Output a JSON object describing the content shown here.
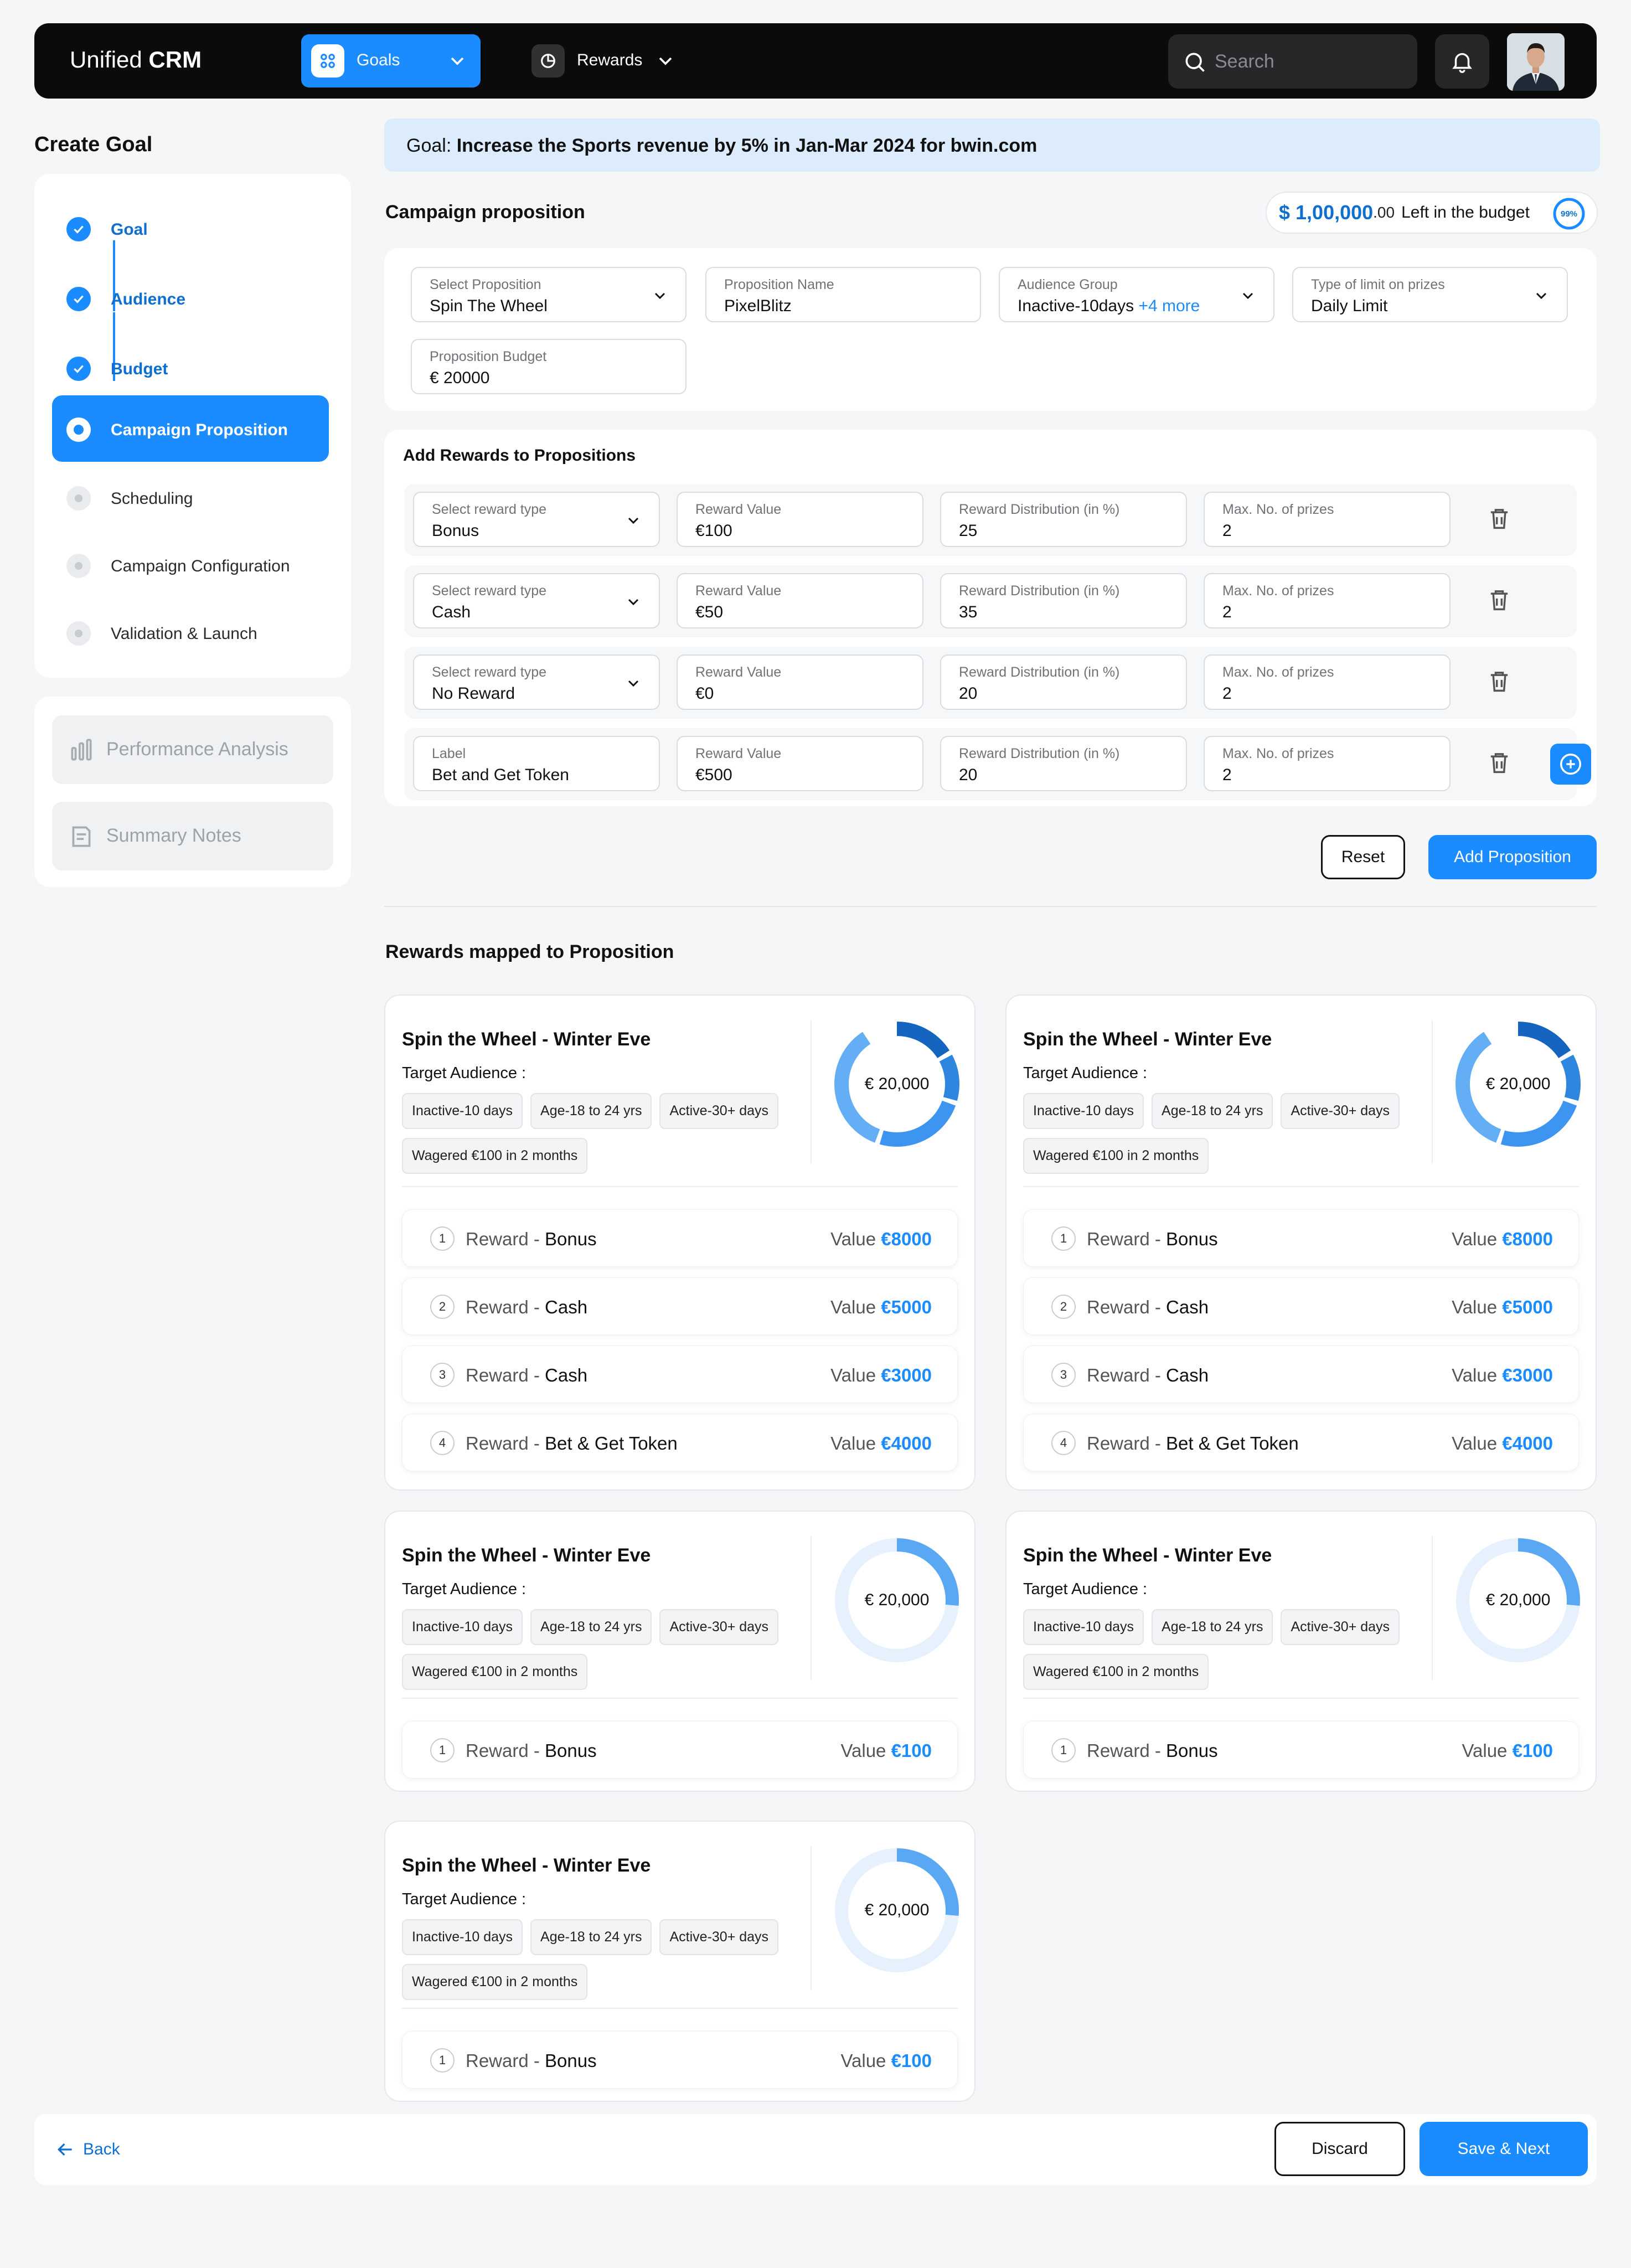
{
  "header": {
    "brand_light": "Unified ",
    "brand_bold": "CRM",
    "nav": [
      {
        "label": "Goals",
        "active": true
      },
      {
        "label": "Rewards",
        "active": false
      }
    ],
    "search_placeholder": "Search"
  },
  "sidebar": {
    "title": "Create Goal",
    "steps": [
      {
        "label": "Goal",
        "state": "done"
      },
      {
        "label": "Audience",
        "state": "done"
      },
      {
        "label": "Budget",
        "state": "done"
      },
      {
        "label": "Campaign Proposition",
        "state": "active"
      },
      {
        "label": "Scheduling",
        "state": "todo"
      },
      {
        "label": "Campaign Configuration",
        "state": "todo"
      },
      {
        "label": "Validation & Launch",
        "state": "todo"
      }
    ],
    "extras": [
      {
        "label": "Performance Analysis"
      },
      {
        "label": "Summary Notes"
      }
    ]
  },
  "goal": {
    "prefix": "Goal: ",
    "text": "Increase the Sports revenue by 5% in Jan-Mar 2024 for bwin.com"
  },
  "campaign": {
    "title": "Campaign proposition",
    "budget": {
      "amount": "$ 1,00,000",
      "cents": ".00",
      "suffix": "Left in the budget",
      "percent_label": "99%",
      "percent": 99
    }
  },
  "proposition_form": {
    "select_proposition": {
      "label": "Select Proposition",
      "value": "Spin The Wheel"
    },
    "proposition_name": {
      "label": "Proposition Name",
      "value": "PixelBlitz"
    },
    "audience_group": {
      "label": "Audience Group",
      "value": "Inactive-10days",
      "more": "+4 more"
    },
    "limit_type": {
      "label": "Type of limit on prizes",
      "value": "Daily Limit"
    },
    "proposition_budget": {
      "label": "Proposition Budget",
      "value": "€ 20000"
    }
  },
  "add_rewards": {
    "title": "Add Rewards to Propositions",
    "col_labels": {
      "value": "Reward Value",
      "distribution": "Reward Distribution (in %)",
      "max": "Max. No. of prizes"
    },
    "rows": [
      {
        "type_label": "Select reward type",
        "type": "Bonus",
        "value": "€100",
        "distribution": "25",
        "max": "2"
      },
      {
        "type_label": "Select reward type",
        "type": "Cash",
        "value": "€50",
        "distribution": "35",
        "max": "2"
      },
      {
        "type_label": "Select reward type",
        "type": "No Reward",
        "value": "€0",
        "distribution": "20",
        "max": "2"
      },
      {
        "type_label": "Label",
        "type": "Bet and Get Token",
        "value": "€500",
        "distribution": "20",
        "max": "2"
      }
    ]
  },
  "actions": {
    "reset": "Reset",
    "add_proposition": "Add Proposition"
  },
  "mapped": {
    "title": "Rewards mapped to Proposition",
    "card_title": "Spin the Wheel - Winter Eve",
    "target_label": "Target Audience :",
    "chips": [
      "Inactive-10 days",
      "Age-18 to 24 yrs",
      "Active-30+ days",
      "Wagered €100 in 2 months"
    ],
    "budget_label": "€ 20,000",
    "reward_word": "Reward",
    "value_word": "Value",
    "cards": [
      {
        "rewards": [
          {
            "n": "1",
            "name": "Bonus",
            "value": "€8000"
          },
          {
            "n": "2",
            "name": "Cash",
            "value": "€5000"
          },
          {
            "n": "3",
            "name": "Cash",
            "value": "€3000"
          },
          {
            "n": "4",
            "name": "Bet & Get Token",
            "value": "€4000"
          }
        ]
      },
      {
        "rewards": [
          {
            "n": "1",
            "name": "Bonus",
            "value": "€8000"
          },
          {
            "n": "2",
            "name": "Cash",
            "value": "€5000"
          },
          {
            "n": "3",
            "name": "Cash",
            "value": "€3000"
          },
          {
            "n": "4",
            "name": "Bet & Get Token",
            "value": "€4000"
          }
        ]
      },
      {
        "rewards": [
          {
            "n": "1",
            "name": "Bonus",
            "value": "€100"
          }
        ]
      },
      {
        "rewards": [
          {
            "n": "1",
            "name": "Bonus",
            "value": "€100"
          }
        ]
      },
      {
        "rewards": [
          {
            "n": "1",
            "name": "Bonus",
            "value": "€100"
          }
        ]
      }
    ]
  },
  "footer": {
    "back": "Back",
    "discard": "Discard",
    "save_next": "Save & Next"
  },
  "colors": {
    "accent": "#1a8cff",
    "accent_dark": "#0f6fd0",
    "banner": "#dcecfd"
  }
}
